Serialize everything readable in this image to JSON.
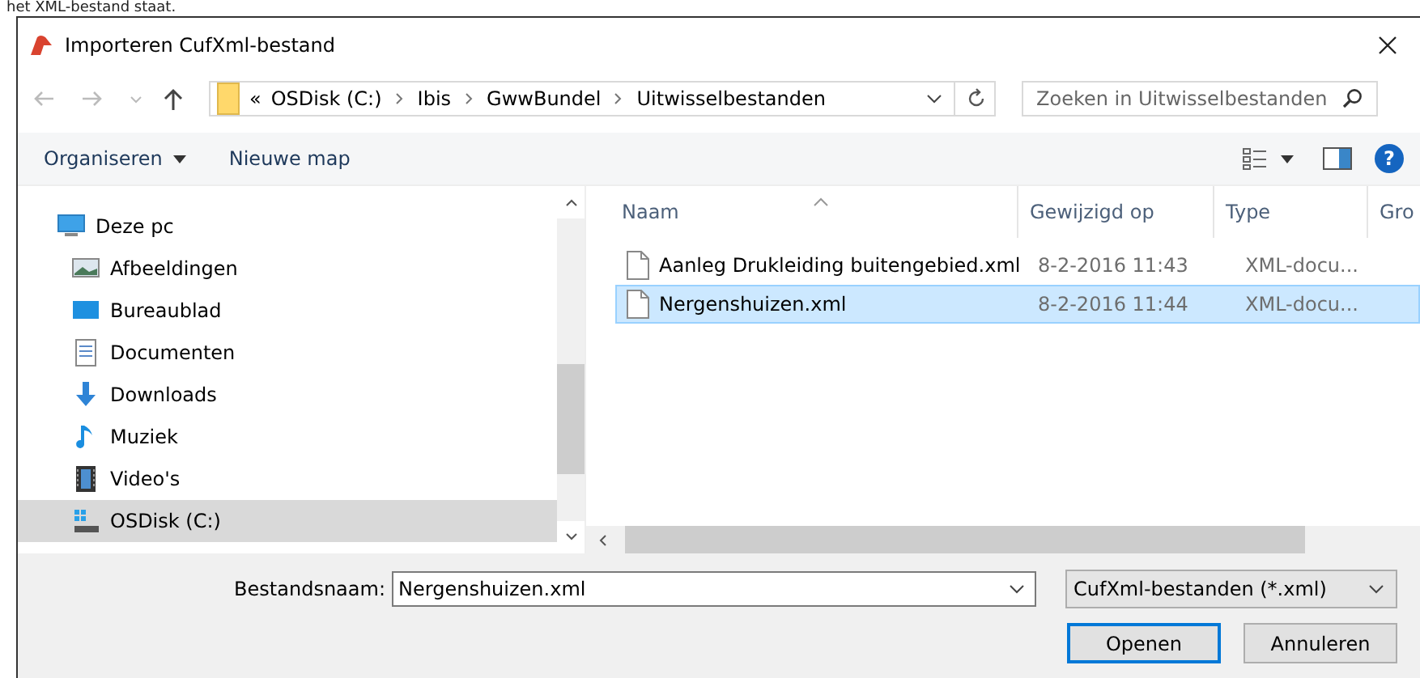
{
  "caption": "het XML-bestand staat.",
  "window": {
    "title": "Importeren CufXml-bestand"
  },
  "address_bar": {
    "overflow": "«",
    "segments": [
      "OSDisk (C:)",
      "Ibis",
      "GwwBundel",
      "Uitwisselbestanden"
    ]
  },
  "search": {
    "placeholder": "Zoeken in Uitwisselbestanden"
  },
  "toolbar": {
    "organise": "Organiseren",
    "new_folder": "Nieuwe map",
    "help": "?"
  },
  "sidebar": {
    "items": [
      {
        "label": "Deze pc",
        "selected": false,
        "children": [
          {
            "label": "Afbeeldingen",
            "selected": false
          },
          {
            "label": "Bureaublad",
            "selected": false
          },
          {
            "label": "Documenten",
            "selected": false
          },
          {
            "label": "Downloads",
            "selected": false
          },
          {
            "label": "Muziek",
            "selected": false
          },
          {
            "label": "Video's",
            "selected": false
          },
          {
            "label": "OSDisk (C:)",
            "selected": true
          }
        ]
      }
    ]
  },
  "table": {
    "columns": [
      "Naam",
      "Gewijzigd op",
      "Type",
      "Gro"
    ],
    "rows": [
      {
        "cells": [
          "Aanleg Drukleiding buitengebied.xml",
          "8-2-2016 11:43",
          "XML-docu..."
        ],
        "selected": false
      },
      {
        "cells": [
          "Nergenshuizen.xml",
          "8-2-2016 11:44",
          "XML-docu..."
        ],
        "selected": true
      }
    ]
  },
  "footer": {
    "filename_label": "Bestandsnaam:",
    "filename": "Nergenshuizen.xml",
    "filter": "CufXml-bestanden (*.xml)",
    "buttons": [
      {
        "label": "Openen",
        "kind": "primary"
      },
      {
        "label": "Annuleren",
        "kind": "normal"
      }
    ]
  }
}
